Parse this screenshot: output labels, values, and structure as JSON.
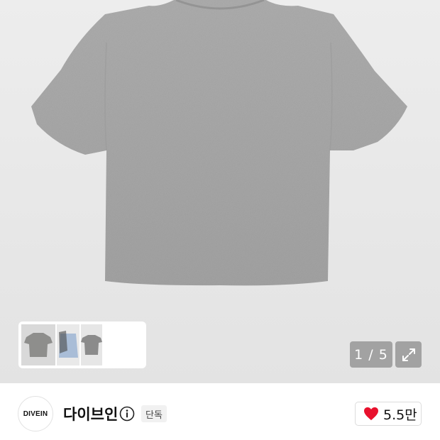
{
  "gallery": {
    "current_index": 1,
    "total": 5,
    "counter_text": "1 / 5",
    "thumbnails": [
      {
        "name": "gray-tshirt"
      },
      {
        "name": "blue-tshirt"
      },
      {
        "name": "charcoal-tshirt"
      }
    ]
  },
  "brand": {
    "logo_text": "DIVEIN",
    "name": "다이브인",
    "badge": "단독"
  },
  "like": {
    "count": "5.5만"
  },
  "colors": {
    "shirt": "#a9a9a9",
    "heart": "#e8112d"
  }
}
